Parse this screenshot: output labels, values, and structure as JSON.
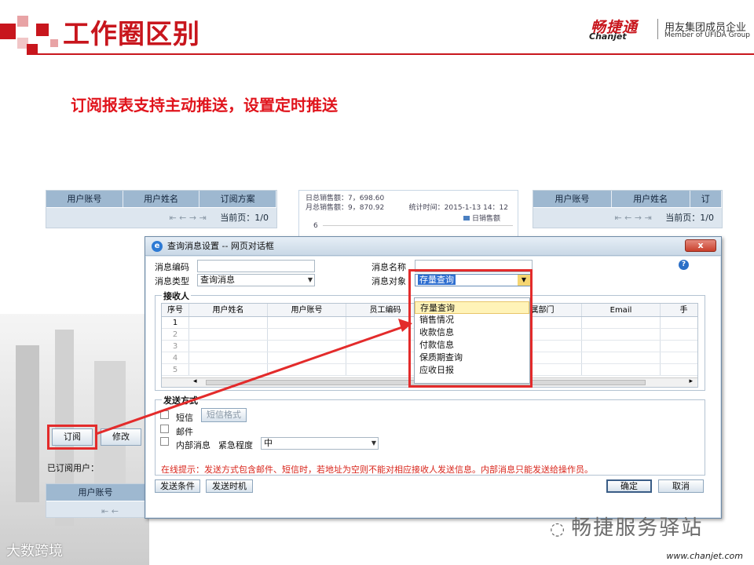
{
  "slide": {
    "title": "工作圈区别",
    "subtitle": "订阅报表支持主动推送，设置定时推送",
    "logo_cn": "畅捷通",
    "logo_en": "Chanjet",
    "logo_tag_cn": "用友集团成员企业",
    "logo_tag_en": "Member of UFIDA Group",
    "footer_url": "www.chanjet.com",
    "wechat_label": "畅捷服务驿站",
    "watermark": "大数跨境",
    "accent_color": "#c8161d"
  },
  "bg_left_table": {
    "headers": [
      "用户账号",
      "用户姓名",
      "订阅方案"
    ],
    "pager": "当前页：1/0"
  },
  "bg_right_table": {
    "headers": [
      "用户账号",
      "用户姓名",
      "订"
    ],
    "pager": "当前页：1/0"
  },
  "bg_chart": {
    "line1": "日总销售额：7，698.60",
    "line2": "月总销售额：9，870.92",
    "stat_time": "统计时间：2015-1-13  14：12",
    "legend": "日销售额",
    "ytick": "6"
  },
  "bg_panel": {
    "subscribe_button": "订阅",
    "modify_button": "修改",
    "subscribed_users": "已订阅用户：",
    "bottom_header": "用户账号"
  },
  "dialog": {
    "title": "查询消息设置 -- 网页对话框",
    "close": "x",
    "msg_code_label": "消息编码",
    "msg_code_value": "",
    "msg_name_label": "消息名称",
    "msg_name_value": "",
    "msg_type_label": "消息类型",
    "msg_type_value": "查询消息",
    "msg_target_label": "消息对象",
    "msg_target_value": "存量查询",
    "receivers_legend": "接收人",
    "grid_headers": [
      "序号",
      "用户姓名",
      "用户账号",
      "员工编码",
      "",
      "属部门",
      "Email",
      "手"
    ],
    "grid_rows": [
      "1",
      "2",
      "3",
      "4",
      "5"
    ],
    "send_legend": "发送方式",
    "sms_label": "短信",
    "sms_format_button": "短信格式",
    "email_label": "邮件",
    "internal_label": "内部消息",
    "urgency_label": "紧急程度",
    "urgency_value": "中",
    "hint": "在线提示：发送方式包含邮件、短信时，若地址为空则不能对相应接收人发送信息。内部消息只能发送给操作员。",
    "send_condition_button": "发送条件",
    "send_time_button": "发送时机",
    "ok_button": "确定",
    "cancel_button": "取消"
  },
  "dropdown": {
    "options": [
      "存量查询",
      "销售情况",
      "收款信息",
      "付款信息",
      "保质期查询",
      "应收日报"
    ],
    "selected": "存量查询"
  }
}
